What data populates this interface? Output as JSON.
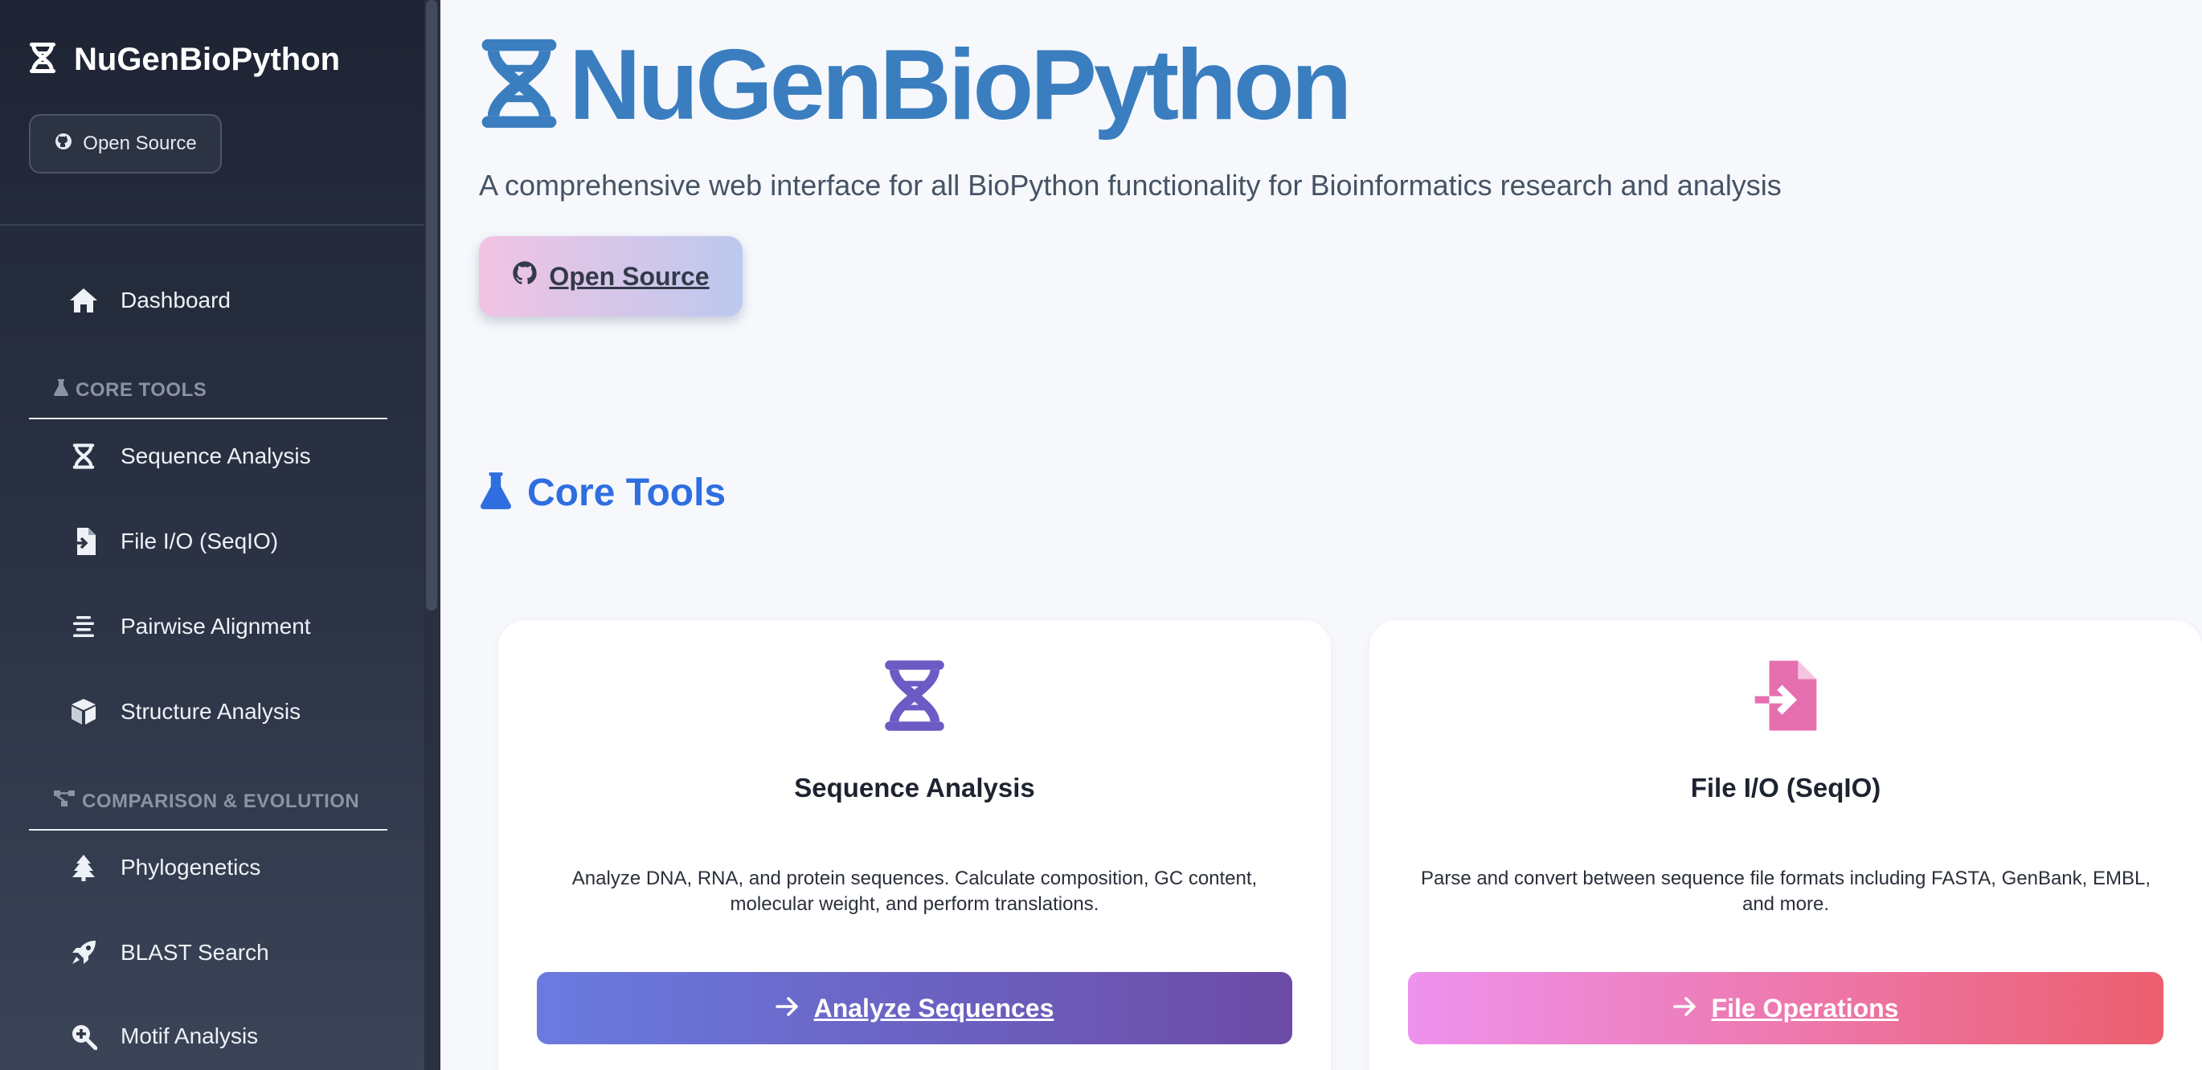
{
  "sidebar": {
    "brand_title": "NuGenBioPython",
    "open_source_label": "Open Source",
    "dashboard_label": "Dashboard",
    "sections": [
      {
        "label": "CORE TOOLS",
        "items": [
          {
            "label": "Sequence Analysis",
            "icon": "dna-icon"
          },
          {
            "label": "File I/O (SeqIO)",
            "icon": "file-import-icon"
          },
          {
            "label": "Pairwise Alignment",
            "icon": "align-center-icon"
          },
          {
            "label": "Structure Analysis",
            "icon": "cube-icon"
          }
        ]
      },
      {
        "label": "COMPARISON & EVOLUTION",
        "items": [
          {
            "label": "Phylogenetics",
            "icon": "tree-icon"
          },
          {
            "label": "BLAST Search",
            "icon": "rocket-icon"
          },
          {
            "label": "Motif Analysis",
            "icon": "search-plus-icon"
          }
        ]
      }
    ]
  },
  "main": {
    "title": "NuGenBioPython",
    "subtitle": "A comprehensive web interface for all BioPython functionality for Bioinformatics research and analysis",
    "open_source_label": "Open Source",
    "section_title": "Core Tools",
    "cards": [
      {
        "title": "Sequence Analysis",
        "description": "Analyze DNA, RNA, and protein sequences. Calculate composition, GC content, molecular weight, and perform translations.",
        "button_label": "Analyze Sequences",
        "icon": "dna-icon",
        "icon_color": "#6b5bc4"
      },
      {
        "title": "File I/O (SeqIO)",
        "description": "Parse and convert between sequence file formats including FASTA, GenBank, EMBL, and more.",
        "button_label": "File Operations",
        "icon": "file-import-icon",
        "icon_color": "#e66fb0"
      }
    ]
  },
  "colors": {
    "sidebar_bg": "#1e2433",
    "brand_blue": "#3a7ec0",
    "section_blue": "#2f6ee0",
    "card_purple": "#6b5bc4",
    "card_pink": "#e66fb0"
  }
}
